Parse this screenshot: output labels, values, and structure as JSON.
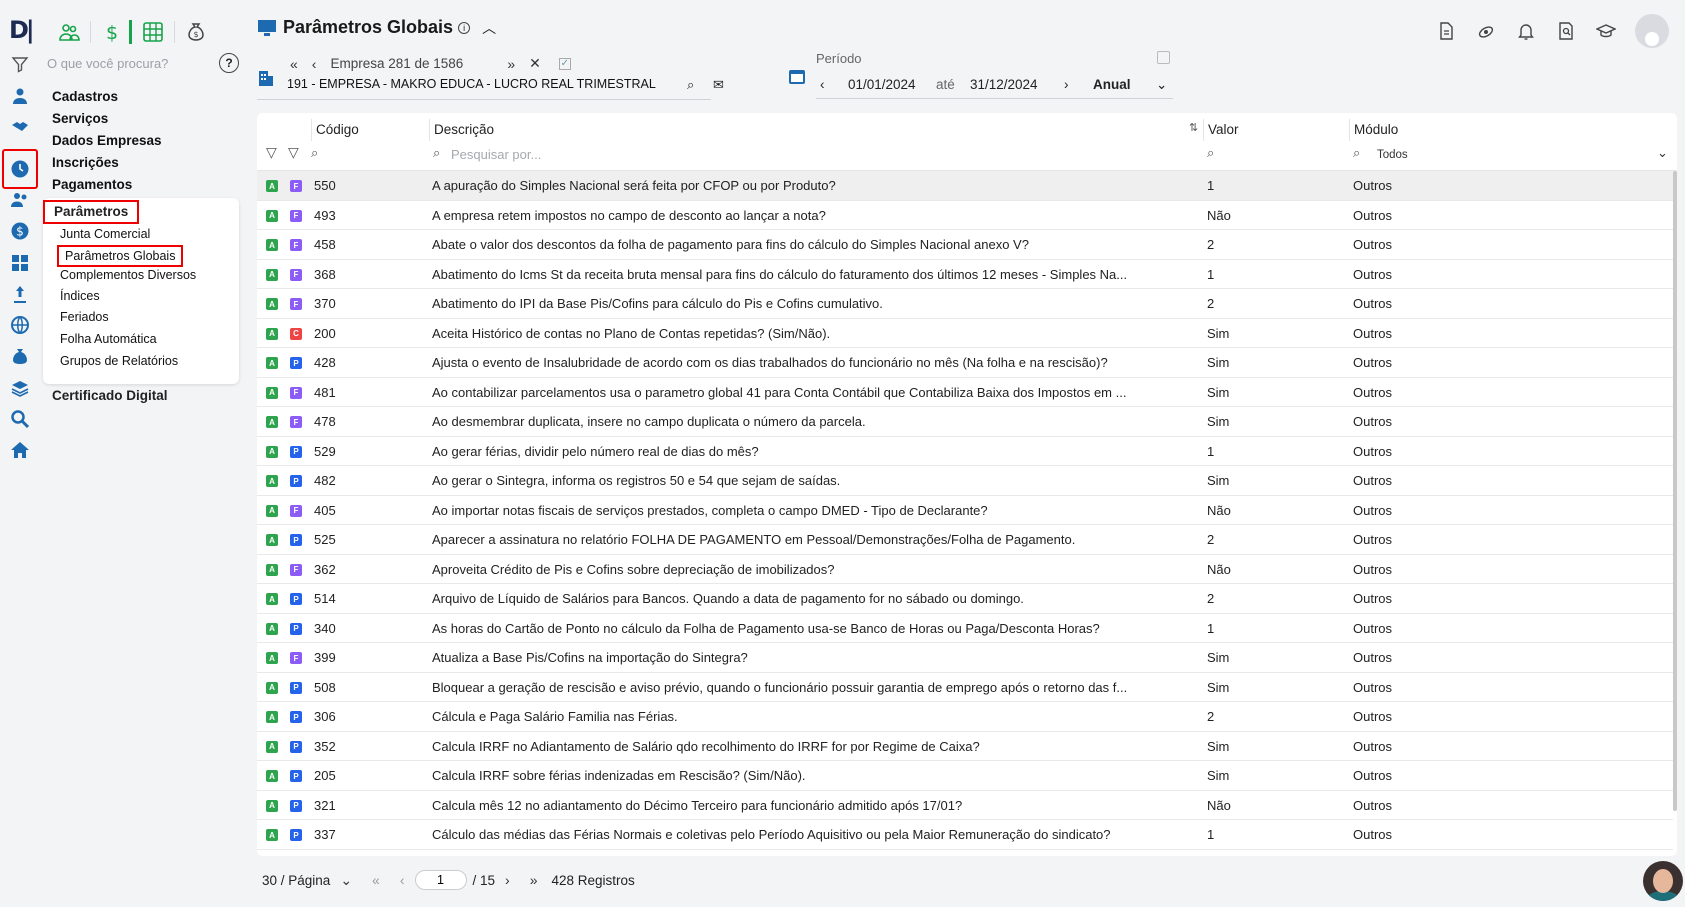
{
  "header": {
    "title": "Parâmetros Globais"
  },
  "search": {
    "placeholder": "O que você procura?"
  },
  "menu": {
    "items": [
      "Cadastros",
      "Serviços",
      "Dados Empresas",
      "Inscrições",
      "Pagamentos"
    ],
    "submenu_title": "Parâmetros",
    "submenu": [
      "Junta Comercial",
      "Parâmetros Globais",
      "Complementos Diversos",
      "Índices",
      "Feriados",
      "Folha Automática",
      "Grupos de Relatórios"
    ],
    "after": "Certificado Digital"
  },
  "empresa": {
    "label": "Empresa 281 de 1586",
    "name": "191 - EMPRESA - MAKRO EDUCA - LUCRO REAL TRIMESTRAL"
  },
  "periodo": {
    "label": "Período",
    "start": "01/01/2024",
    "ate": "até",
    "end": "31/12/2024",
    "mode": "Anual"
  },
  "table": {
    "headers": {
      "codigo": "Código",
      "descricao": "Descrição",
      "valor": "Valor",
      "modulo": "Módulo"
    },
    "filter_placeholder": "Pesquisar por...",
    "modulo_filter": "Todos",
    "rows": [
      {
        "m": "F",
        "c": "550",
        "d": "A apuração do Simples Nacional será feita por CFOP ou por Produto?",
        "v": "1",
        "mod": "Outros"
      },
      {
        "m": "F",
        "c": "493",
        "d": "A empresa retem impostos no campo de desconto ao lançar a nota?",
        "v": "Não",
        "mod": "Outros"
      },
      {
        "m": "F",
        "c": "458",
        "d": "Abate o valor dos descontos da folha de pagamento para fins do cálculo do Simples Nacional anexo V?",
        "v": "2",
        "mod": "Outros"
      },
      {
        "m": "F",
        "c": "368",
        "d": "Abatimento do Icms St da receita bruta mensal para fins do cálculo do faturamento dos últimos 12 meses - Simples Na...",
        "v": "1",
        "mod": "Outros"
      },
      {
        "m": "F",
        "c": "370",
        "d": "Abatimento do IPI da Base Pis/Cofins para cálculo do Pis e Cofins cumulativo.",
        "v": "2",
        "mod": "Outros"
      },
      {
        "m": "C",
        "c": "200",
        "d": "Aceita Histórico de contas no Plano de Contas repetidas? (Sim/Não).",
        "v": "Sim",
        "mod": "Outros"
      },
      {
        "m": "P",
        "c": "428",
        "d": "Ajusta o evento de Insalubridade de acordo com os dias trabalhados do funcionário no mês (Na folha e na rescisão)?",
        "v": "Sim",
        "mod": "Outros"
      },
      {
        "m": "F",
        "c": "481",
        "d": "Ao contabilizar parcelamentos usa o parametro global 41 para Conta Contábil que Contabiliza Baixa dos Impostos em ...",
        "v": "Sim",
        "mod": "Outros"
      },
      {
        "m": "F",
        "c": "478",
        "d": "Ao desmembrar duplicata, insere no campo duplicata o número da parcela.",
        "v": "Sim",
        "mod": "Outros"
      },
      {
        "m": "P",
        "c": "529",
        "d": "Ao gerar férias, dividir pelo número real de dias do mês?",
        "v": "1",
        "mod": "Outros"
      },
      {
        "m": "P",
        "c": "482",
        "d": "Ao gerar o Sintegra, informa os registros 50 e 54 que sejam de saídas.",
        "v": "Sim",
        "mod": "Outros"
      },
      {
        "m": "F",
        "c": "405",
        "d": "Ao importar notas fiscais de serviços prestados, completa o campo DMED - Tipo de Declarante?",
        "v": "Não",
        "mod": "Outros"
      },
      {
        "m": "P",
        "c": "525",
        "d": "Aparecer a assinatura no relatório FOLHA DE PAGAMENTO em Pessoal/Demonstrações/Folha de Pagamento.",
        "v": "2",
        "mod": "Outros"
      },
      {
        "m": "F",
        "c": "362",
        "d": "Aproveita Crédito de Pis e Cofins sobre depreciação de imobilizados?",
        "v": "Não",
        "mod": "Outros"
      },
      {
        "m": "P",
        "c": "514",
        "d": "Arquivo de Líquido de Salários para Bancos. Quando a data de pagamento for no sábado ou domingo.",
        "v": "2",
        "mod": "Outros"
      },
      {
        "m": "P",
        "c": "340",
        "d": "As horas do Cartão de Ponto no cálculo da Folha de Pagamento usa-se Banco de Horas ou Paga/Desconta Horas?",
        "v": "1",
        "mod": "Outros"
      },
      {
        "m": "F",
        "c": "399",
        "d": "Atualiza a Base Pis/Cofins na importação do Sintegra?",
        "v": "Sim",
        "mod": "Outros"
      },
      {
        "m": "P",
        "c": "508",
        "d": "Bloquear a geração de rescisão e aviso prévio, quando o funcionário possuir garantia de emprego após o retorno das f...",
        "v": "Sim",
        "mod": "Outros"
      },
      {
        "m": "P",
        "c": "306",
        "d": "Cálcula e Paga Salário Familia nas Férias.",
        "v": "2",
        "mod": "Outros"
      },
      {
        "m": "P",
        "c": "352",
        "d": "Calcula IRRF no Adiantamento de Salário qdo recolhimento do IRRF for por Regime de Caixa?",
        "v": "Sim",
        "mod": "Outros"
      },
      {
        "m": "P",
        "c": "205",
        "d": "Calcula IRRF sobre férias indenizadas em Rescisão? (Sim/Não).",
        "v": "Sim",
        "mod": "Outros"
      },
      {
        "m": "P",
        "c": "321",
        "d": "Calcula mês 12 no adiantamento do Décimo Terceiro para funcionário admitido após 17/01?",
        "v": "Não",
        "mod": "Outros"
      },
      {
        "m": "P",
        "c": "337",
        "d": "Cálculo das médias das Férias Normais e coletivas pelo Período Aquisitivo ou pela Maior Remuneração do sindicato?",
        "v": "1",
        "mod": "Outros"
      }
    ]
  },
  "pager": {
    "per_page": "30 / Página",
    "page": "1",
    "of": "/ 15",
    "total": "428 Registros"
  },
  "colors": {
    "A": "#2ea44f",
    "F": "#8b5cf6",
    "P": "#2563eb",
    "C": "#ef4444"
  }
}
